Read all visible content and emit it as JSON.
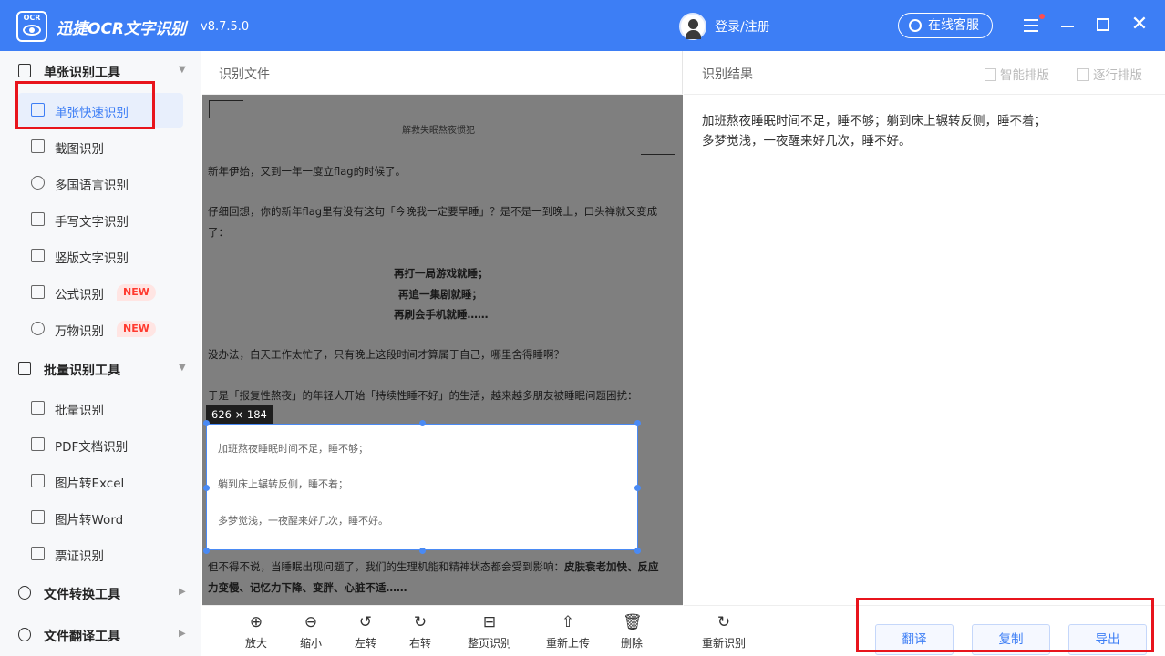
{
  "app": {
    "name": "迅捷OCR文字识别",
    "version": "v8.7.5.0",
    "logo_text": "OCR",
    "login": "登录/注册",
    "service": "在线客服"
  },
  "sidebar": {
    "sections": [
      {
        "label": "单张识别工具",
        "icon": "single-doc-icon"
      },
      {
        "label": "批量识别工具",
        "icon": "batch-doc-icon"
      },
      {
        "label": "文件转换工具",
        "icon": "convert-icon"
      },
      {
        "label": "文件翻译工具",
        "icon": "translate-icon"
      }
    ],
    "single_items": [
      {
        "label": "单张快速识别",
        "icon": "quick-scan-icon"
      },
      {
        "label": "截图识别",
        "icon": "crop-icon"
      },
      {
        "label": "多国语言识别",
        "icon": "globe-icon"
      },
      {
        "label": "手写文字识别",
        "icon": "pen-icon"
      },
      {
        "label": "竖版文字识别",
        "icon": "vertical-text-icon"
      },
      {
        "label": "公式识别",
        "icon": "formula-icon",
        "badge": "NEW"
      },
      {
        "label": "万物识别",
        "icon": "objects-icon",
        "badge": "NEW"
      }
    ],
    "batch_items": [
      {
        "label": "批量识别",
        "icon": "copy-icon"
      },
      {
        "label": "PDF文档识别",
        "icon": "pdf-icon"
      },
      {
        "label": "图片转Excel",
        "icon": "excel-icon"
      },
      {
        "label": "图片转Word",
        "icon": "word-icon"
      },
      {
        "label": "票证识别",
        "icon": "ticket-icon"
      }
    ]
  },
  "file_panel": {
    "title": "识别文件",
    "doc": {
      "heading": "解救失眠熬夜惯犯",
      "p1": "新年伊始，又到一年一度立flag的时候了。",
      "p2a": "仔细回想，你的新年flag里有没有这句「今晚我一定要早睡」？是不是一到晚上，口头禅就又变成",
      "p2b": "了：",
      "c1": "再打一局游戏就睡；",
      "c2": "再追一集剧就睡；",
      "c3": "再刷会手机就睡……",
      "p3": "没办法，白天工作太忙了，只有晚上这段时间才算属于自己，哪里舍得睡啊？",
      "p4": "于是「报复性熬夜」的年轻人开始「持续性睡不好」的生活，越来越多朋友被睡眠问题困扰：",
      "sel1": "加班熬夜睡眠时间不足，睡不够；",
      "sel2": "躺到床上辗转反侧，睡不着；",
      "sel3": "多梦觉浅，一夜醒来好几次，睡不好。",
      "p5a": "但不得不说，当睡眠出现问题了，我们的生理机能和精神状态都会受到影响：",
      "p5b": "皮肤衰老加快、反应",
      "p5c": "力变慢、记忆力下降、变胖、心脏不适……"
    },
    "selection_size": "626 × 184",
    "tools": [
      {
        "label": "放大",
        "icon": "zoom-in-icon"
      },
      {
        "label": "缩小",
        "icon": "zoom-out-icon"
      },
      {
        "label": "左转",
        "icon": "rotate-left-icon"
      },
      {
        "label": "右转",
        "icon": "rotate-right-icon"
      },
      {
        "label": "整页识别",
        "icon": "full-page-icon"
      },
      {
        "label": "重新上传",
        "icon": "upload-icon"
      },
      {
        "label": "删除",
        "icon": "trash-icon"
      }
    ]
  },
  "result_panel": {
    "title": "识别结果",
    "smart_layout": "智能排版",
    "line_layout": "逐行排版",
    "line1": "加班熬夜睡眠时间不足，睡不够；躺到床上辗转反侧，睡不着；",
    "line2": "多梦觉浅，一夜醒来好几次，睡不好。",
    "reocr": "重新识别",
    "translate": "翻译",
    "copy": "复制",
    "export": "导出"
  },
  "colors": {
    "accent": "#3d7ef5",
    "highlight": "#e8141c",
    "badge": "#ff3b30"
  }
}
